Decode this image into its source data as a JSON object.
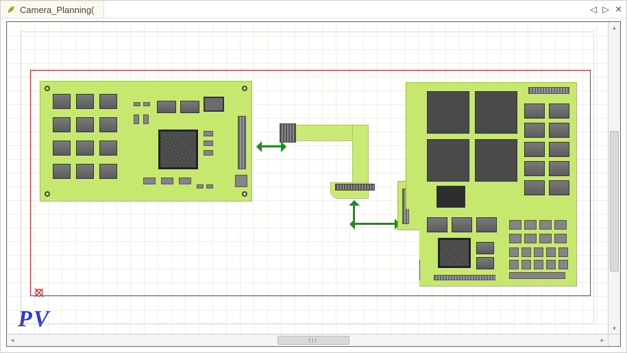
{
  "titlebar": {
    "tab_label": "Camera_Planning(",
    "controls": {
      "prev": "◁",
      "next": "▷",
      "close": "✕"
    }
  },
  "watermark": "PV",
  "scroll_thumb_label": "III",
  "hscroll_arrows": {
    "left": "◂",
    "right": "▸"
  },
  "vscroll_arrows": {
    "up": "▴",
    "down": "▾"
  }
}
